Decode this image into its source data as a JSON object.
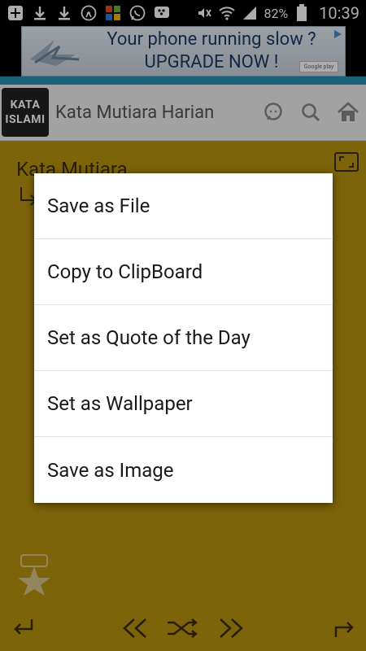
{
  "status_bar": {
    "battery_percent": "82%",
    "time": "10:39"
  },
  "ad": {
    "line1": "Your phone running slow ?",
    "line2": "UPGRADE NOW !",
    "store_badge": "Google play"
  },
  "app_bar": {
    "logo_line1": "KATA",
    "logo_line2": "ISLAMI",
    "title": "Kata Mutiara Harian"
  },
  "content": {
    "title": "Kata Mutiara"
  },
  "dialog": {
    "items": [
      {
        "label": "Save as File"
      },
      {
        "label": "Copy to ClipBoard"
      },
      {
        "label": "Set as Quote of the Day"
      },
      {
        "label": "Set as Wallpaper"
      },
      {
        "label": "Save as Image"
      }
    ]
  },
  "colors": {
    "background": "#b8930f",
    "accent_teal": "#2a8fb5",
    "appbar": "#efefef"
  }
}
